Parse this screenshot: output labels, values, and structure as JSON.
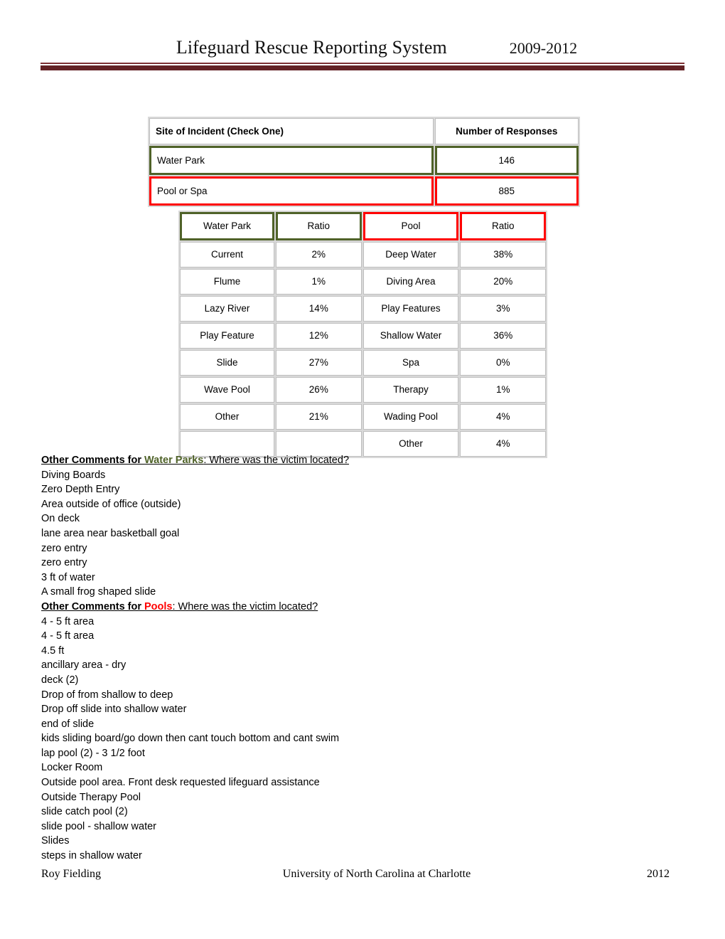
{
  "header": {
    "title": "Lifeguard Rescue Reporting System",
    "years": "2009-2012"
  },
  "colors": {
    "green": "#4F6228",
    "red": "#FF0000",
    "maroon": "#632225"
  },
  "site_table": {
    "headers": [
      "Site of Incident (Check One)",
      "Number of Responses"
    ],
    "rows": [
      {
        "site": "Water Park",
        "responses": "146",
        "highlight": "green"
      },
      {
        "site": "Pool or Spa",
        "responses": "885",
        "highlight": "red"
      }
    ]
  },
  "ratio_table": {
    "headers": [
      "Water Park",
      "Ratio",
      "Pool",
      "Ratio"
    ],
    "rows": [
      {
        "waterpark": "Current",
        "wp_ratio": "2%",
        "pool": "Deep Water",
        "pool_ratio": "38%"
      },
      {
        "waterpark": "Flume",
        "wp_ratio": "1%",
        "pool": "Diving Area",
        "pool_ratio": "20%"
      },
      {
        "waterpark": "Lazy River",
        "wp_ratio": "14%",
        "pool": "Play Features",
        "pool_ratio": "3%"
      },
      {
        "waterpark": "Play Feature",
        "wp_ratio": "12%",
        "pool": "Shallow Water",
        "pool_ratio": "36%"
      },
      {
        "waterpark": "Slide",
        "wp_ratio": "27%",
        "pool": "Spa",
        "pool_ratio": "0%"
      },
      {
        "waterpark": "Wave Pool",
        "wp_ratio": "26%",
        "pool": "Therapy",
        "pool_ratio": "1%"
      },
      {
        "waterpark": "Other",
        "wp_ratio": "21%",
        "pool": "Wading Pool",
        "pool_ratio": "4%"
      },
      {
        "waterpark": "",
        "wp_ratio": "",
        "pool": "Other",
        "pool_ratio": "4%"
      }
    ]
  },
  "comments": {
    "waterpark_heading": {
      "prefix": "Other Comments for ",
      "keyword": "Water Parks",
      "suffix": ": Where was the victim located?"
    },
    "waterpark_items": [
      "Diving Boards",
      "Zero Depth Entry",
      "Area outside of office (outside)",
      "On deck",
      "lane area near basketball goal",
      "zero entry",
      "zero entry",
      "3 ft of water",
      "A small frog shaped slide"
    ],
    "pool_heading": {
      "prefix": "Other Comments for ",
      "keyword": "Pools",
      "suffix": ": Where was the victim located?"
    },
    "pool_items": [
      "4 - 5 ft area",
      "4 - 5 ft area",
      "4.5 ft",
      "ancillary area - dry",
      "deck (2)",
      "Drop of from shallow to deep",
      "Drop off slide into shallow water",
      "end of slide",
      "kids sliding board/go down then cant touch bottom and cant swim",
      "lap pool (2) - 3 1/2 foot",
      "Locker Room",
      "Outside pool area. Front desk requested lifeguard assistance",
      "Outside Therapy Pool",
      "slide catch pool (2)",
      "slide pool - shallow water",
      "Slides",
      "steps in shallow water"
    ]
  },
  "footer": {
    "author": "Roy Fielding",
    "organization": "University of North Carolina at Charlotte",
    "year": "2012"
  }
}
